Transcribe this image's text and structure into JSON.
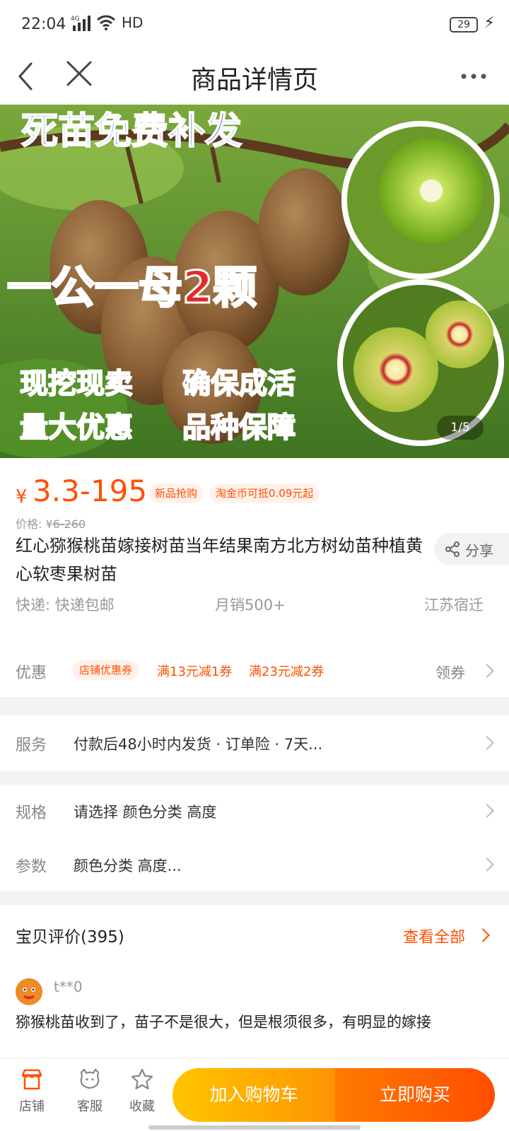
{
  "status_bar": {
    "time": "22:04",
    "network": "4G",
    "hd": "HD",
    "battery": "29"
  },
  "nav": {
    "title": "商品详情页"
  },
  "hero": {
    "banner_top": "死苗免费补发",
    "banner_middle": "一公一母2颗",
    "banner_line1_left": "现挖现卖",
    "banner_line1_right": "确保成活",
    "banner_line2_left": "量大优惠",
    "banner_line2_right": "品种保障",
    "counter": "1/5"
  },
  "product": {
    "currency": "¥",
    "price_range": "3.3-195",
    "tag_new": "新品抢购",
    "tag_coins": "淘金币可抵0.09元起",
    "orig_price_label": "价格: ¥",
    "orig_price_value": "6-260",
    "title": "红心猕猴桃苗嫁接树苗当年结果南方北方树幼苗种植黄心软枣果树苗",
    "share": "分享",
    "shipping": "快递: 快递包邮",
    "monthly_sales": "月销500+",
    "location": "江苏宿迁"
  },
  "coupon": {
    "label": "优惠",
    "shop_coupon": "店铺优惠券",
    "coupon1": "满13元减1券",
    "coupon2": "满23元减2券",
    "action": "领券"
  },
  "service": {
    "label": "服务",
    "text": "付款后48小时内发货 · 订单险 · 7天..."
  },
  "spec": {
    "label": "规格",
    "text": "请选择 颜色分类 高度"
  },
  "params": {
    "label": "参数",
    "text": "颜色分类 高度..."
  },
  "reviews": {
    "title": "宝贝评价(395)",
    "view_all": "查看全部",
    "reviewer": "t**0",
    "text": "猕猴桃苗收到了，苗子不是很大，但是根须很多，有明显的嫁接"
  },
  "bottom_bar": {
    "shop": "店铺",
    "service": "客服",
    "favorite": "收藏",
    "add_cart": "加入购物车",
    "buy_now": "立即购买"
  },
  "colors": {
    "accent": "#ff5000",
    "cart_button": "#ffa500",
    "buy_button": "#ff5a00"
  }
}
